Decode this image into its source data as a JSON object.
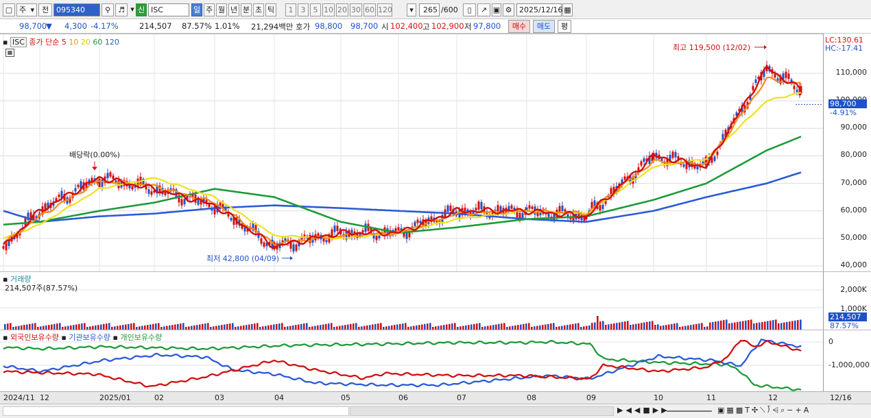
{
  "toolbar": {
    "market": "주",
    "prev": "전",
    "code": "095340",
    "company_badge": "신",
    "company": "ISC",
    "periods": [
      "일",
      "주",
      "월",
      "년",
      "분",
      "초",
      "틱"
    ],
    "intervals": [
      "1",
      "3",
      "5",
      "10",
      "20",
      "30",
      "60",
      "120"
    ],
    "count": "265",
    "count_max": "/600",
    "date": "2025/12/16"
  },
  "quote": {
    "price": "98,700",
    "arrow": "▼",
    "change": "4,300",
    "change_pct": "-4.17%",
    "volume": "214,507",
    "volume_ratio": "87.57%",
    "turnover_ratio": "1.01%",
    "amount": "21,294백만",
    "ask_label": "호가",
    "ask": "98,800",
    "bid": "98,700",
    "open_label": "시",
    "open": "102,400",
    "high_label": "고",
    "high": "102,900",
    "low_label": "저",
    "low": "97,800",
    "buy_btn": "매수",
    "sell_btn": "매도",
    "eval_btn": "평"
  },
  "price_panel": {
    "symbol": "ISC",
    "legend_title": "종가 단순",
    "ma_labels": [
      "5",
      "10",
      "20",
      "60",
      "120"
    ],
    "ma_colors": [
      "#d01010",
      "#f08c1c",
      "#f0e020",
      "#1e9a3a",
      "#2a5ad8"
    ],
    "lc": "LC:130.61",
    "hc": "HC:-17.41",
    "price_tag": "98,700",
    "price_tag_pct": "-4.91%",
    "y_ticks": [
      "110,000",
      "100,000",
      "90,000",
      "80,000",
      "70,000",
      "60,000",
      "50,000",
      "40,000"
    ],
    "annotations": {
      "high": "최고 119,500 (12/02)",
      "low": "최저 42,800 (04/09)",
      "dividend": "배당락(0.00%)"
    }
  },
  "volume_panel": {
    "title": "거래량",
    "value_label": "214,507주(87.57%)",
    "y_ticks": [
      "2,000K",
      "1,000K"
    ],
    "tag": "214,507",
    "tag_pct": "87.57%"
  },
  "holdings_panel": {
    "legend": [
      "외국인보유수량",
      "기관보유수량",
      "개인보유수량"
    ],
    "legend_colors": [
      "#d01010",
      "#2a5ad8",
      "#1e9a3a"
    ],
    "y_ticks": [
      "0",
      "-1,000,000"
    ]
  },
  "x_axis": {
    "labels": [
      "2024/11",
      "12",
      "2025/01",
      "02",
      "03",
      "04",
      "05",
      "06",
      "07",
      "08",
      "09",
      "10",
      "11",
      "12"
    ],
    "right_label": "12/16"
  },
  "chart_data": {
    "type": "line",
    "x": [
      "2024-11",
      "2024-12",
      "2025-01",
      "2025-02",
      "2025-03",
      "2025-04",
      "2025-05",
      "2025-06",
      "2025-07",
      "2025-08",
      "2025-09",
      "2025-10",
      "2025-11",
      "2025-12-02",
      "2025-12-16"
    ],
    "series": [
      {
        "name": "5",
        "values": [
          47000,
          60000,
          72000,
          68000,
          62000,
          47000,
          52000,
          52000,
          60000,
          60000,
          58000,
          80000,
          76000,
          112000,
          104000
        ]
      },
      {
        "name": "10",
        "values": [
          48000,
          58000,
          71000,
          69000,
          63000,
          48000,
          51000,
          52000,
          59000,
          60000,
          59000,
          78000,
          77000,
          108000,
          106000
        ]
      },
      {
        "name": "20",
        "values": [
          50000,
          55000,
          68000,
          72000,
          65000,
          51000,
          50000,
          52000,
          57000,
          60000,
          59000,
          76000,
          79000,
          100000,
          103000
        ]
      },
      {
        "name": "60",
        "values": [
          55000,
          56000,
          60000,
          63000,
          68000,
          65000,
          56000,
          52000,
          54000,
          57000,
          58000,
          64000,
          70000,
          82000,
          87000
        ]
      },
      {
        "name": "120",
        "values": [
          60000,
          56000,
          58000,
          59000,
          61000,
          62000,
          61000,
          60000,
          59000,
          57000,
          56000,
          60000,
          65000,
          70000,
          74000
        ]
      }
    ],
    "ylim": [
      38000,
      130000
    ],
    "high": {
      "date": "12/02",
      "value": 119500
    },
    "low": {
      "date": "04/09",
      "value": 42800
    },
    "last": 98700
  }
}
